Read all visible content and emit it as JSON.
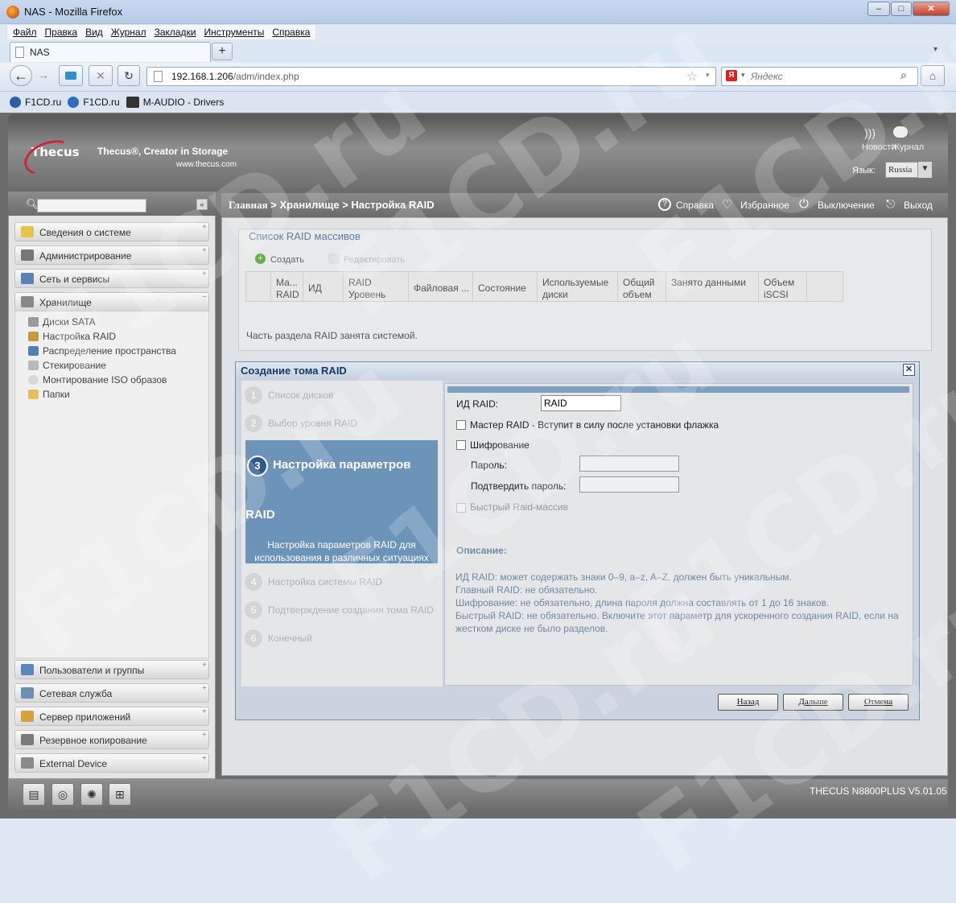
{
  "browser": {
    "window_title": "NAS - Mozilla Firefox",
    "menu": [
      "Файл",
      "Правка",
      "Вид",
      "Журнал",
      "Закладки",
      "Инструменты",
      "Справка"
    ],
    "tab_title": "NAS",
    "url_host": "192.168.1.206",
    "url_path": "/adm/index.php",
    "search_placeholder": "Яндекс",
    "bookmarks": [
      "F1CD.ru",
      "F1CD.ru",
      "M-AUDIO - Drivers"
    ]
  },
  "header": {
    "logo": "Thecus",
    "slogan": "Thecus®, Creator in Storage",
    "site": "www.thecus.com",
    "news": "Новости",
    "journal": "Журнал",
    "language_label": "Язык:",
    "language_value": "Russia"
  },
  "sidebar": {
    "categories_top": [
      "Сведения о системе",
      "Администрирование",
      "Сеть и сервисы",
      "Хранилище"
    ],
    "storage_items": [
      "Диски SATA",
      "Настройка RAID",
      "Распределение пространства",
      "Стекирование",
      "Монтирование ISO образов",
      "Папки"
    ],
    "categories_bottom": [
      "Пользователи и группы",
      "Сетевая служба",
      "Сервер приложений",
      "Резервное копирование",
      "External Device"
    ]
  },
  "breadcrumb": {
    "home": "Главная",
    "path": " > Хранилище > Настройка RAID"
  },
  "top_links": {
    "help": "Справка",
    "favorites": "Избранное",
    "shutdown": "Выключение",
    "logout": "Выход"
  },
  "raid_list": {
    "caption": "Список RAID массивов",
    "create": "Создать",
    "edit": "Редактировать",
    "columns": [
      "Ма... RAID",
      "ИД",
      "RAID Уровень",
      "Файловая ...",
      "Состояние",
      "Используемые диски",
      "Общий объем",
      "Занято данными",
      "Объем iSCSI"
    ],
    "note": "Часть раздела RAID занята системой."
  },
  "dialog": {
    "title": "Создание тома RAID",
    "steps": [
      {
        "num": "1",
        "label": "Список дисков"
      },
      {
        "num": "2",
        "label": "Выбор уровня RAID"
      },
      {
        "num": "3",
        "label": "Настройка параметров"
      },
      {
        "num": "4",
        "label": "Настройка системы RAID"
      },
      {
        "num": "5",
        "label": "Подтверждение создания тома RAID"
      },
      {
        "num": "6",
        "label": "Конечный"
      }
    ],
    "active_title_line2": "RAID",
    "active_desc": "Настройка параметров RAID для использования в различных ситуациях",
    "form": {
      "raid_id_label": "ИД RAID:",
      "raid_id_value": "RAID",
      "master_label": "Мастер RAID - Вступит в силу после установки флажка",
      "encryption_label": "Шифрование",
      "password_label": "Пароль:",
      "confirm_label": "Подтвердить пароль:",
      "quick_label": "Быстрый Raid-массив",
      "desc_heading": "Описание:",
      "desc_lines": [
        "ИД RAID: может содержать знаки 0–9, a–z, A–Z, должен быть уникальным.",
        "Главный RAID: не обязательно.",
        "Шифрование: не обязательно, длина пароля должна составлять от 1 до 16 знаков.",
        "Быстрый RAID: не обязательно. Включите этот параметр для ускоренного создания RAID, если на жестком диске не было разделов."
      ]
    },
    "buttons": {
      "back": "Назад",
      "next": "Дальше",
      "cancel": "Отмена"
    }
  },
  "footer": {
    "version": "THECUS N8800PLUS V5.01.05"
  },
  "watermark": "F1CD.ru"
}
